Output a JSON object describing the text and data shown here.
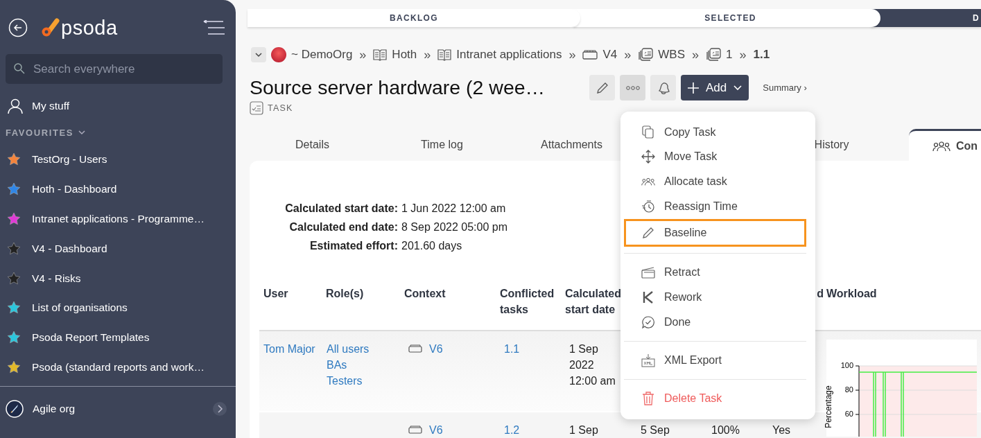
{
  "sidebar": {
    "logo": "psoda",
    "search": {
      "placeholder": "Search everywhere"
    },
    "my_stuff": "My stuff",
    "favourites_heading": "FAVOURITES",
    "favourites": [
      {
        "label": "TestOrg - Users",
        "color": "#f5843c"
      },
      {
        "label": "Hoth - Dashboard",
        "color": "#2f86e8"
      },
      {
        "label": "Intranet applications - Programme…",
        "color": "#e03ad6"
      },
      {
        "label": "V4 - Dashboard",
        "color": "#222222"
      },
      {
        "label": "V4 - Risks",
        "color": "#222222"
      },
      {
        "label": "List of organisations",
        "color": "#2cc6dc"
      },
      {
        "label": "Psoda Report Templates",
        "color": "#2cc6dc"
      },
      {
        "label": "Psoda (standard reports and work…",
        "color": "#e2b92a"
      }
    ],
    "organisation": "Agile org"
  },
  "stages": [
    {
      "label": "BACKLOG",
      "selected": false
    },
    {
      "label": "SELECTED",
      "selected": false
    },
    {
      "label": "D",
      "selected": true
    }
  ],
  "breadcrumbs": [
    {
      "label": "~ DemoOrg",
      "kind": "org"
    },
    {
      "label": "Hoth",
      "kind": "book",
      "separator": "»"
    },
    {
      "label": "Intranet applications",
      "kind": "book",
      "separator": "»"
    },
    {
      "label": "V4",
      "kind": "board",
      "separator": "»"
    },
    {
      "label": "WBS",
      "kind": "stack",
      "separator": "»"
    },
    {
      "label": "1",
      "kind": "stack",
      "separator": "»"
    },
    {
      "label": "1.1",
      "kind": "current",
      "separator": "»"
    }
  ],
  "title": "Source server hardware (2 wee…",
  "type_label": "TASK",
  "add_button": "Add",
  "summary_link": "Summary ›",
  "tabs": [
    {
      "label": "Details",
      "selected": false
    },
    {
      "label": "Time log",
      "selected": false
    },
    {
      "label": "Attachments",
      "selected": false
    },
    {
      "label": "History",
      "selected": false
    },
    {
      "label": "Con",
      "selected": true
    }
  ],
  "details": [
    {
      "label": "Calculated start date:",
      "value": "1 Jun 2022 12:00 am"
    },
    {
      "label": "Calculated end date:",
      "value": "8 Sep 2022 05:00 pm"
    },
    {
      "label": "Estimated effort:",
      "value": "201.60 days"
    }
  ],
  "table": {
    "columns": [
      "User",
      "Role(s)",
      "Context",
      "Conflicted tasks",
      "Calculated start date"
    ],
    "column_8": "d",
    "workload_column": "Workload",
    "rows": [
      {
        "user": "Tom Major",
        "roles": [
          "All users",
          "BAs",
          "Testers"
        ],
        "context": "V6",
        "conflicted": "1.1",
        "start": "1 Sep 2022 12:00 am"
      },
      {
        "context": "V6",
        "conflicted": "1.2",
        "start": "1 Sep",
        "column_6": "5 Sep",
        "column_7": "100%",
        "column_8": "Yes"
      }
    ],
    "workload_chart": {
      "axis_label": "Percentage",
      "tick_labels": [
        "100",
        "80",
        "60"
      ]
    }
  },
  "menu": [
    {
      "label": "Copy Task",
      "kind": "item",
      "highlighted": false,
      "divider_before": false
    },
    {
      "label": "Move Task",
      "kind": "item",
      "highlighted": false,
      "divider_before": false
    },
    {
      "label": "Allocate task",
      "kind": "item",
      "highlighted": false,
      "divider_before": false
    },
    {
      "label": "Reassign Time",
      "kind": "item",
      "highlighted": false,
      "divider_before": false
    },
    {
      "label": "Baseline",
      "kind": "item",
      "highlighted": true,
      "divider_before": false
    },
    {
      "label": "Retract",
      "kind": "item",
      "highlighted": false,
      "divider_before": true
    },
    {
      "label": "Rework",
      "kind": "item",
      "highlighted": false,
      "divider_before": false
    },
    {
      "label": "Done",
      "kind": "item",
      "highlighted": false,
      "divider_before": false
    },
    {
      "label": "XML Export",
      "kind": "item",
      "highlighted": false,
      "divider_before": true
    },
    {
      "label": "Delete Task",
      "kind": "danger",
      "highlighted": false,
      "divider_before": true
    }
  ]
}
